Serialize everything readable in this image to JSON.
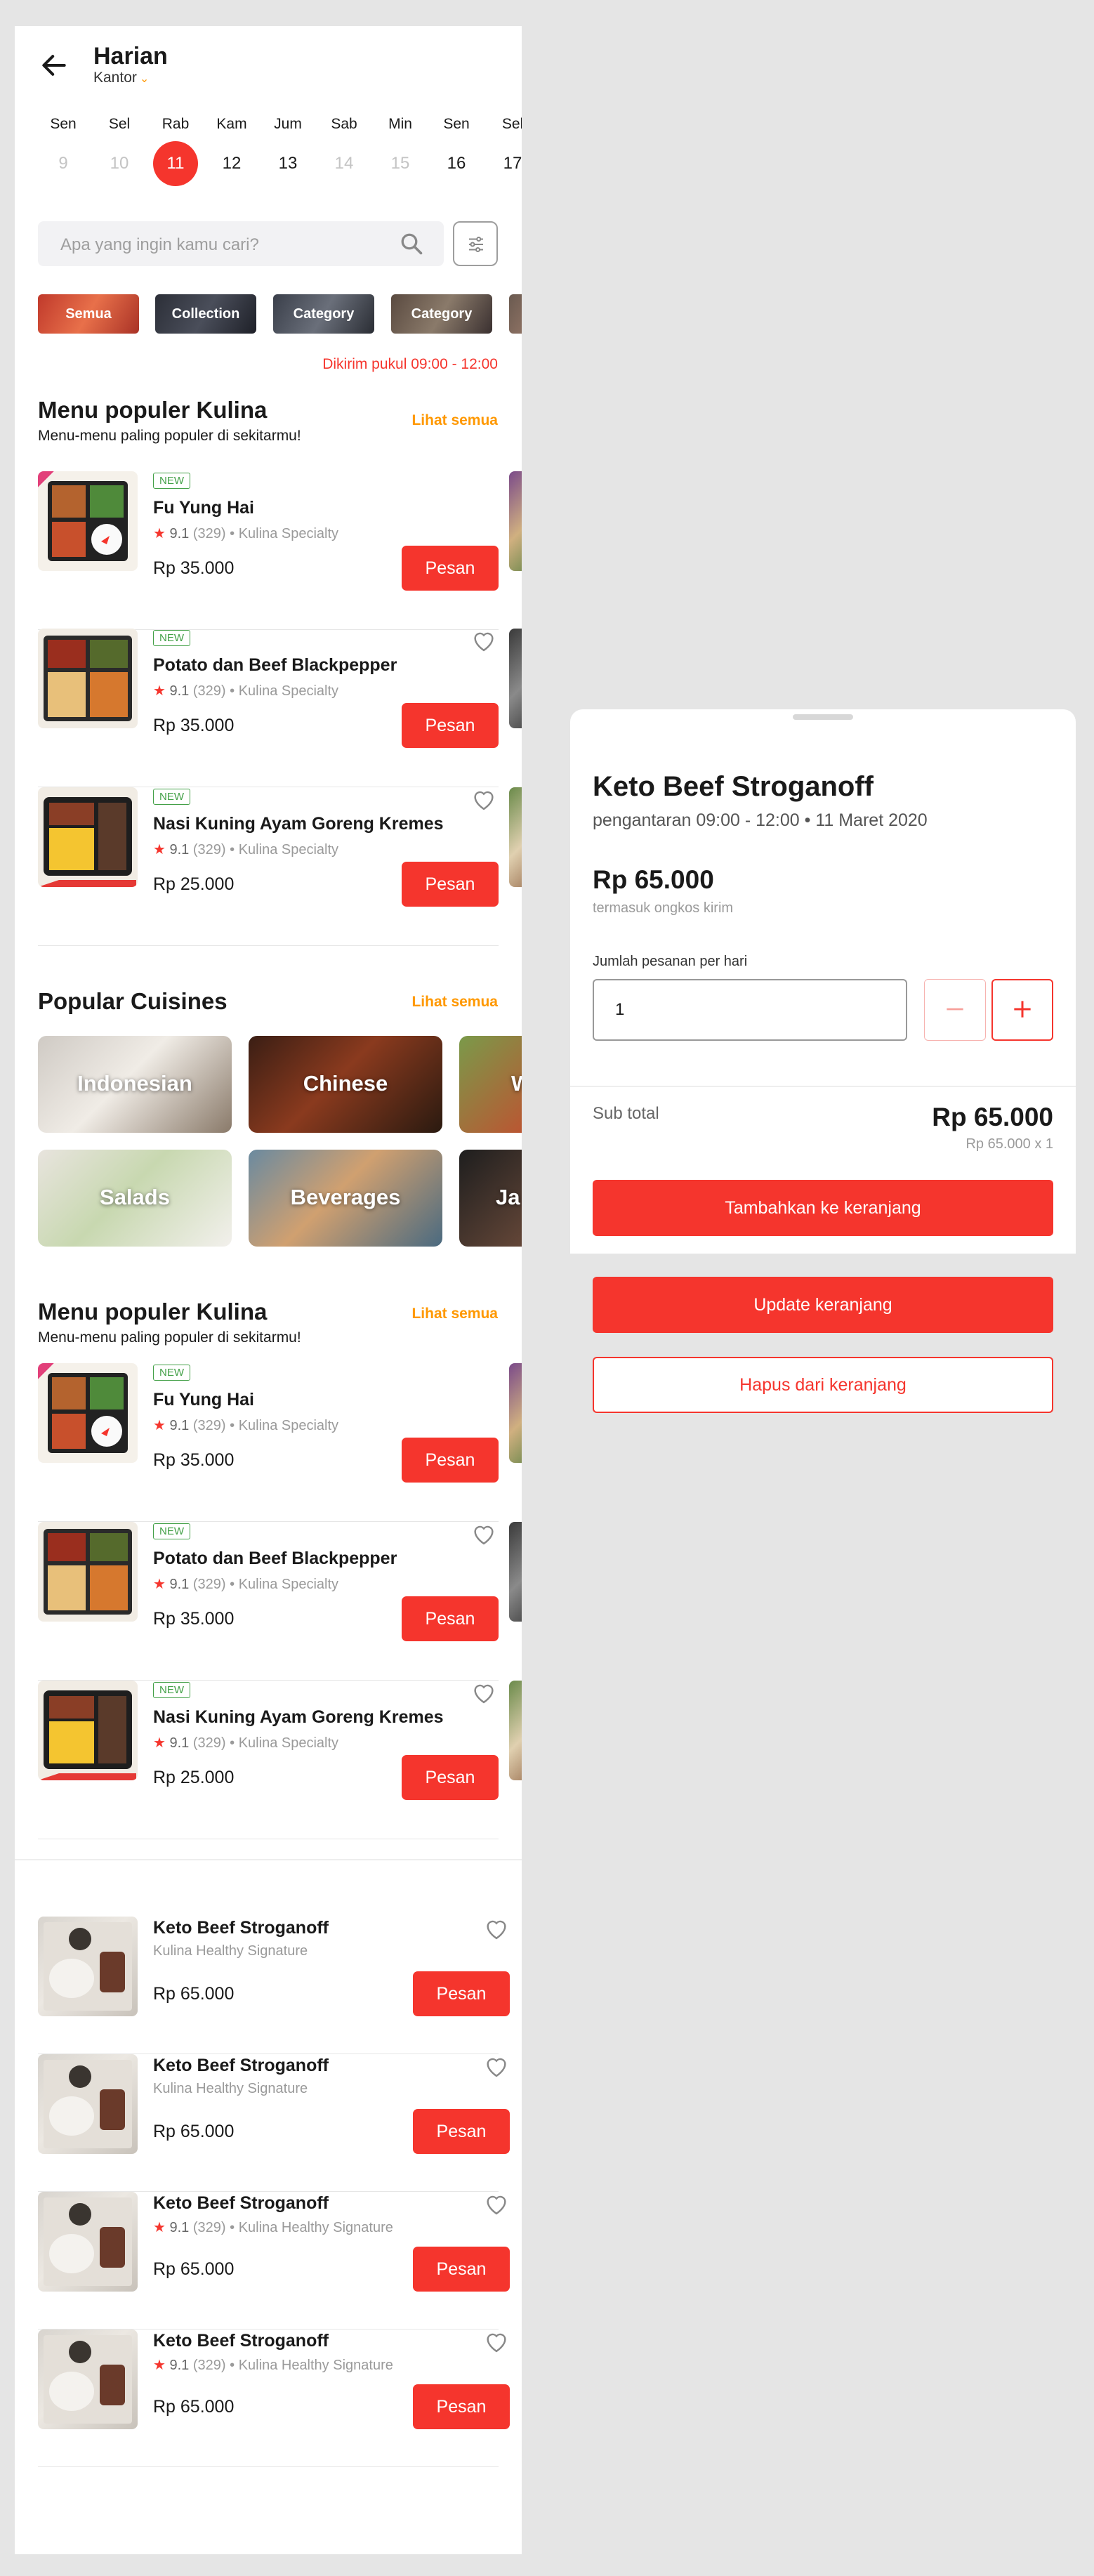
{
  "header": {
    "title": "Harian",
    "location": "Kantor"
  },
  "dates": [
    {
      "day": "Sen",
      "num": "9",
      "state": "disabled"
    },
    {
      "day": "Sel",
      "num": "10",
      "state": "disabled"
    },
    {
      "day": "Rab",
      "num": "11",
      "state": "selected"
    },
    {
      "day": "Kam",
      "num": "12",
      "state": "normal"
    },
    {
      "day": "Jum",
      "num": "13",
      "state": "normal"
    },
    {
      "day": "Sab",
      "num": "14",
      "state": "disabled"
    },
    {
      "day": "Min",
      "num": "15",
      "state": "disabled"
    },
    {
      "day": "Sen",
      "num": "16",
      "state": "normal"
    },
    {
      "day": "Sel",
      "num": "17",
      "state": "normal"
    }
  ],
  "search": {
    "placeholder": "Apa yang ingin kamu cari?"
  },
  "chips": [
    "Semua",
    "Collection",
    "Category",
    "Category",
    ""
  ],
  "delivery_text": "Dikirim pukul 09:00 - 12:00",
  "section1": {
    "title": "Menu populer Kulina",
    "subtitle": "Menu-menu paling populer di sekitarmu!",
    "link": "Lihat semua",
    "items": [
      {
        "badge": "NEW",
        "name": "Fu Yung Hai",
        "star": "★",
        "rating": "9.1",
        "count": "(329)",
        "sep": "•",
        "brand": "Kulina Specialty",
        "price": "Rp 35.000",
        "button": "Pesan",
        "heart": false
      },
      {
        "badge": "NEW",
        "name": "Potato dan Beef Blackpepper",
        "star": "★",
        "rating": "9.1",
        "count": "(329)",
        "sep": "•",
        "brand": "Kulina Specialty",
        "price": "Rp 35.000",
        "button": "Pesan",
        "heart": true
      },
      {
        "badge": "NEW",
        "name": "Nasi Kuning Ayam Goreng Kremes",
        "star": "★",
        "rating": "9.1",
        "count": "(329)",
        "sep": "•",
        "brand": "Kulina Specialty",
        "price": "Rp 25.000",
        "button": "Pesan",
        "heart": true
      }
    ]
  },
  "cuisines": {
    "title": "Popular Cuisines",
    "link": "Lihat semua",
    "items": [
      "Indonesian",
      "Chinese",
      "W",
      "Salads",
      "Beverages",
      "Ja"
    ]
  },
  "section2": {
    "title": "Menu populer Kulina",
    "subtitle": "Menu-menu paling populer di sekitarmu!",
    "link": "Lihat semua",
    "items": [
      {
        "badge": "NEW",
        "name": "Fu Yung Hai",
        "star": "★",
        "rating": "9.1",
        "count": "(329)",
        "sep": "•",
        "brand": "Kulina Specialty",
        "price": "Rp 35.000",
        "button": "Pesan"
      },
      {
        "badge": "NEW",
        "name": "Potato dan Beef Blackpepper",
        "star": "★",
        "rating": "9.1",
        "count": "(329)",
        "sep": "•",
        "brand": "Kulina Specialty",
        "price": "Rp 35.000",
        "button": "Pesan"
      },
      {
        "badge": "NEW",
        "name": "Nasi Kuning Ayam Goreng Kremes",
        "star": "★",
        "rating": "9.1",
        "count": "(329)",
        "sep": "•",
        "brand": "Kulina Specialty",
        "price": "Rp 25.000",
        "button": "Pesan"
      }
    ]
  },
  "keto_list": [
    {
      "name": "Keto Beef Stroganoff",
      "sub": "Kulina Healthy Signature",
      "price": "Rp 65.000",
      "button": "Pesan"
    },
    {
      "name": "Keto Beef Stroganoff",
      "sub": "Kulina Healthy Signature",
      "price": "Rp 65.000",
      "button": "Pesan"
    },
    {
      "name": "Keto Beef Stroganoff",
      "star": "★",
      "rating": "9.1",
      "count": "(329)",
      "sep": "•",
      "brand": "Kulina Healthy Signature",
      "price": "Rp 65.000",
      "button": "Pesan"
    },
    {
      "name": "Keto Beef Stroganoff",
      "star": "★",
      "rating": "9.1",
      "count": "(329)",
      "sep": "•",
      "brand": "Kulina Healthy Signature",
      "price": "Rp 65.000",
      "button": "Pesan"
    }
  ],
  "sheet": {
    "title": "Keto Beef Stroganoff",
    "subtitle": "pengantaran 09:00 - 12:00 • 11 Maret 2020",
    "price": "Rp 65.000",
    "price_note": "termasuk ongkos kirim",
    "qty_label": "Jumlah pesanan per hari",
    "qty_value": "1",
    "subtotal_label": "Sub total",
    "subtotal": "Rp 65.000",
    "subtotal_detail": "Rp 65.000 x 1",
    "add_button": "Tambahkan ke keranjang"
  },
  "actions": {
    "update": "Update keranjang",
    "remove": "Hapus dari keranjang"
  },
  "colors": {
    "primary": "#f5352d",
    "accent": "#ff9800",
    "new_badge": "#43a047"
  }
}
